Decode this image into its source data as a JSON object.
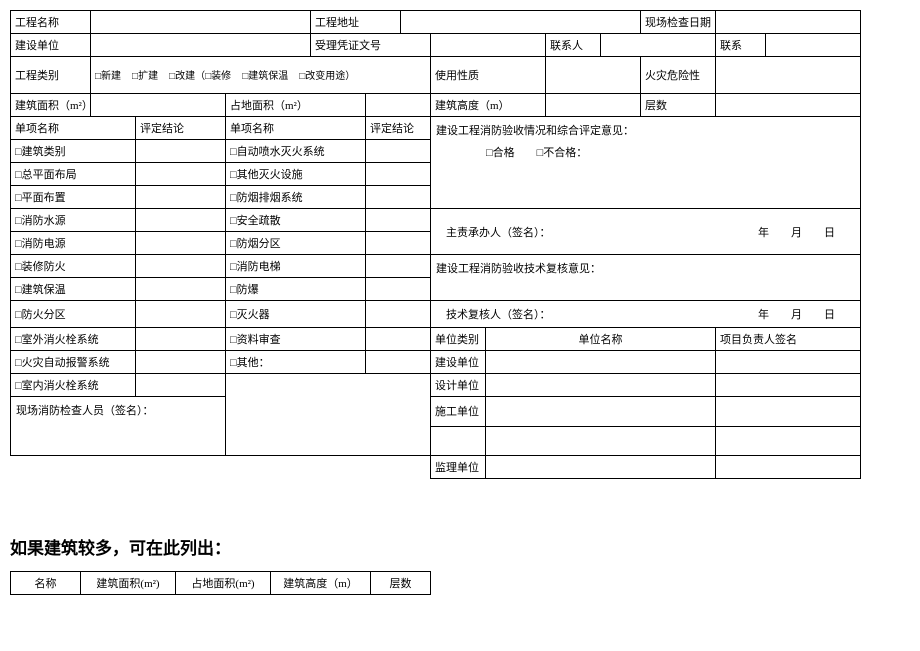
{
  "labels": {
    "name": "工程名称",
    "addr": "工程地址",
    "inspDate": "现场检查日期",
    "builder": "建设单位",
    "docNo": "受理凭证文号",
    "contact": "联系人",
    "phone": "联系",
    "category": "工程类别",
    "c_new": "□新建",
    "c_ext": "□扩建",
    "c_reb": "□改建（□装修",
    "c_ins": "□建筑保温",
    "c_use": "□改变用途）",
    "useNature": "使用性质",
    "fireRisk": "火灾危险性",
    "bArea": "建筑面积（m²）",
    "lArea": "占地面积（m²）",
    "bHeight": "建筑高度（m）",
    "floors": "层数",
    "itemName": "单项名称",
    "verdict": "评定结论",
    "opinion": "建设工程消防验收情况和综合评定意见：",
    "pass": "□合格",
    "fail": "□不合格：",
    "handler": "主责承办人（签名）：",
    "review": "建设工程消防验收技术复核意见：",
    "reviewer": "技术复核人（签名）：",
    "date": "年　　月　　日",
    "utype": "单位类别",
    "uname": "单位名称",
    "pmSign": "项目负责人签名",
    "uBuild": "建设单位",
    "uDesign": "设计单位",
    "uCons": "施工单位",
    "uSup": "监理单位",
    "inspector": "现场消防检查人员（签名）：",
    "footer": "如果建筑较多，可在此列出：",
    "f_name": "名称",
    "f_barea": "建筑面积(m²)",
    "f_larea": "占地面积(m²)",
    "f_height": "建筑高度（m）",
    "f_floors": "层数"
  },
  "itemsA": [
    "□建筑类别",
    "□总平面布局",
    "□平面布置",
    "□消防水源",
    "□消防电源",
    "□装修防火",
    "□建筑保温",
    "□防火分区",
    "□室外消火栓系统",
    "□火灾自动报警系统",
    "□室内消火栓系统"
  ],
  "itemsB": [
    "□自动喷水灭火系统",
    "□其他灭火设施",
    "□防烟排烟系统",
    "□安全疏散",
    "□防烟分区",
    "□消防电梯",
    "□防爆",
    "□灭火器",
    "□资料审查",
    "□其他："
  ]
}
